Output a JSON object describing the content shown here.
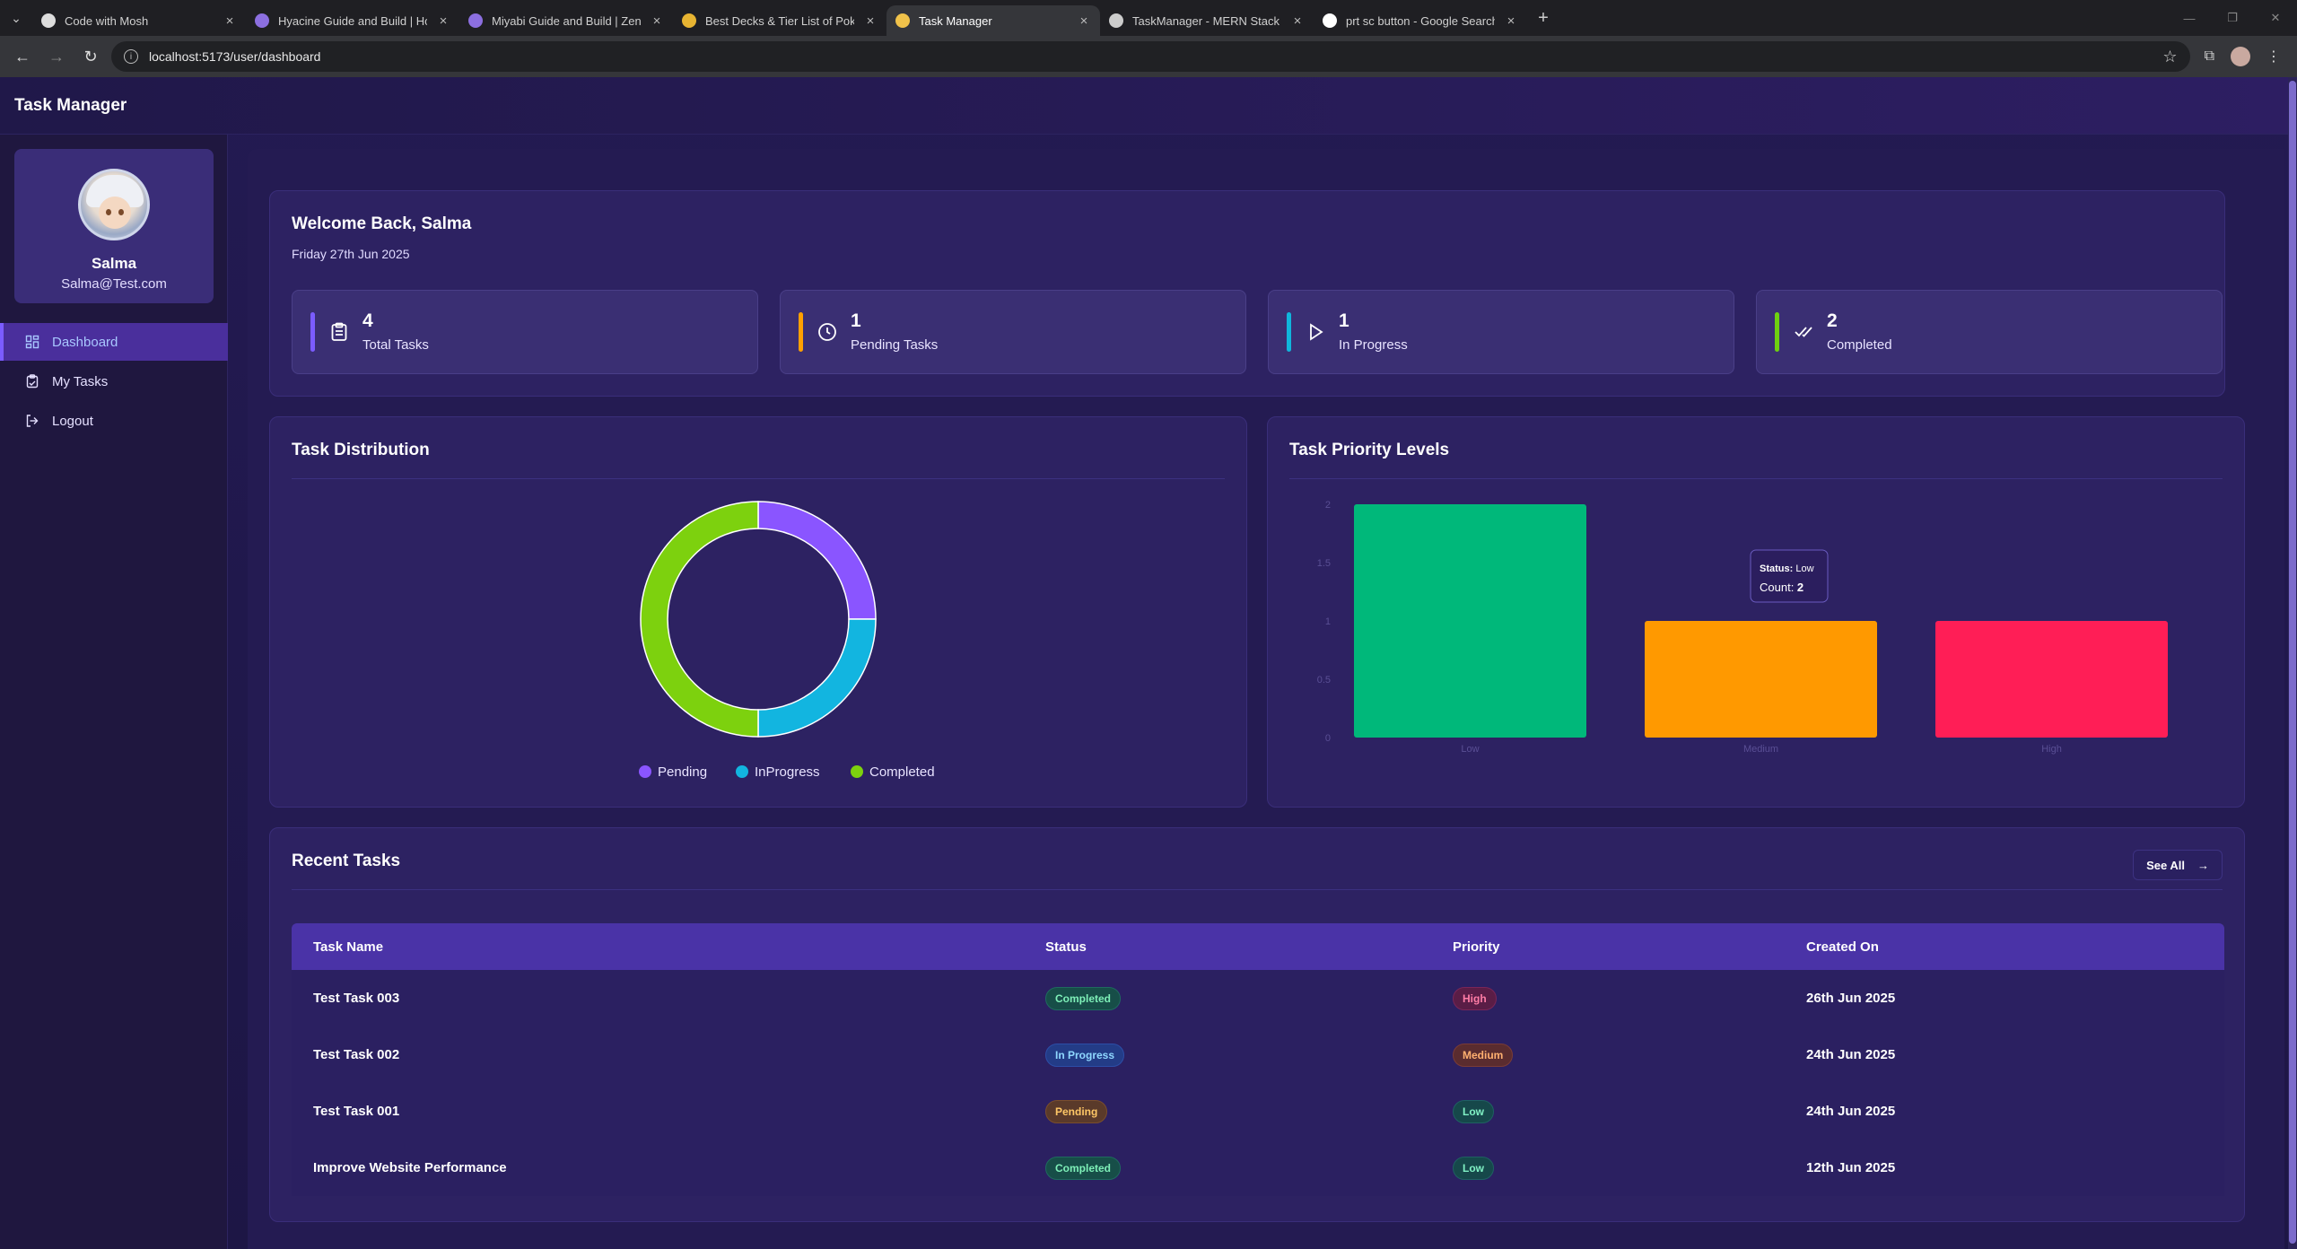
{
  "browser": {
    "tabs": [
      {
        "label": "Code with Mosh",
        "active": false
      },
      {
        "label": "Hyacine Guide and Build | Honk",
        "active": false
      },
      {
        "label": "Miyabi Guide and Build | Zenle",
        "active": false
      },
      {
        "label": "Best Decks & Tier List of Pokém",
        "active": false
      },
      {
        "label": "Task Manager",
        "active": true
      },
      {
        "label": "TaskManager - MERN Stack Pro",
        "active": false
      },
      {
        "label": "prt sc button - Google Search",
        "active": false
      }
    ],
    "url": "localhost:5173/user/dashboard"
  },
  "app": {
    "title": "Task Manager"
  },
  "profile": {
    "name": "Salma",
    "email": "Salma@Test.com"
  },
  "sidebar": {
    "items": [
      {
        "label": "Dashboard",
        "icon": "dashboard-icon",
        "active": true
      },
      {
        "label": "My Tasks",
        "icon": "clipboard-icon",
        "active": false
      },
      {
        "label": "Logout",
        "icon": "logout-icon",
        "active": false
      }
    ]
  },
  "welcome": {
    "title": "Welcome Back, Salma",
    "date": "Friday 27th Jun 2025"
  },
  "stats": [
    {
      "value": "4",
      "label": "Total Tasks",
      "color": "#7b5cff",
      "icon": "clipboard-icon"
    },
    {
      "value": "1",
      "label": "Pending Tasks",
      "color": "#ffa000",
      "icon": "clock-icon"
    },
    {
      "value": "1",
      "label": "In Progress",
      "color": "#10b6dc",
      "icon": "play-icon"
    },
    {
      "value": "2",
      "label": "Completed",
      "color": "#6ed010",
      "icon": "double-check-icon"
    }
  ],
  "distribution": {
    "title": "Task Distribution",
    "legend": [
      {
        "label": "Pending",
        "color": "#8a55ff"
      },
      {
        "label": "InProgress",
        "color": "#12b5e0"
      },
      {
        "label": "Completed",
        "color": "#7dd10e"
      }
    ]
  },
  "priority": {
    "title": "Task Priority Levels",
    "tooltip": {
      "status_label": "Status:",
      "status_value": "Low",
      "count_label": "Count:",
      "count_value": "2"
    }
  },
  "chart_data": [
    {
      "type": "pie",
      "donut": true,
      "categories": [
        "Pending",
        "InProgress",
        "Completed"
      ],
      "values": [
        1,
        1,
        2
      ],
      "colors": [
        "#8a55ff",
        "#12b5e0",
        "#7dd10e"
      ],
      "legend": "bottom"
    },
    {
      "type": "bar",
      "categories": [
        "Low",
        "Medium",
        "High"
      ],
      "values": [
        2,
        1,
        1
      ],
      "colors": [
        "#00b87a",
        "#ff9900",
        "#ff1e56"
      ],
      "ylim": [
        0,
        2
      ],
      "yticks": [
        "0",
        "0.5",
        "1",
        "1.5",
        "2"
      ],
      "grid": false
    }
  ],
  "recent": {
    "title": "Recent Tasks",
    "see_all": "See All",
    "columns": [
      "Task Name",
      "Status",
      "Priority",
      "Created On"
    ],
    "rows": [
      {
        "name": "Test Task 003",
        "status": "Completed",
        "status_class": "completed",
        "priority": "High",
        "priority_class": "high",
        "created": "26th Jun 2025"
      },
      {
        "name": "Test Task 002",
        "status": "In Progress",
        "status_class": "inprogress",
        "priority": "Medium",
        "priority_class": "medium",
        "created": "24th Jun 2025"
      },
      {
        "name": "Test Task 001",
        "status": "Pending",
        "status_class": "pending",
        "priority": "Low",
        "priority_class": "low",
        "created": "24th Jun 2025"
      },
      {
        "name": "Improve Website Performance",
        "status": "Completed",
        "status_class": "completed",
        "priority": "Low",
        "priority_class": "low",
        "created": "12th Jun 2025"
      }
    ]
  }
}
